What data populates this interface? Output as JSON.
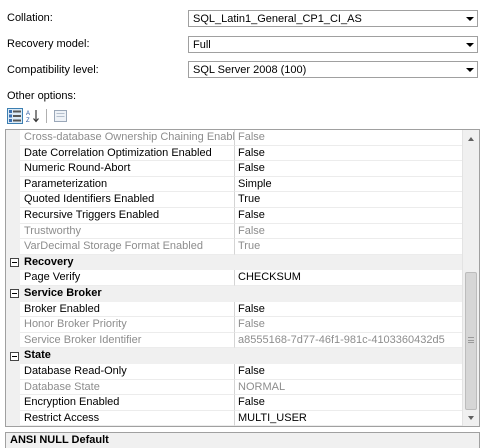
{
  "fields": {
    "collation": {
      "label": "Collation:",
      "value": "SQL_Latin1_General_CP1_CI_AS"
    },
    "recovery_model": {
      "label": "Recovery model:",
      "value": "Full"
    },
    "compatibility_level": {
      "label": "Compatibility level:",
      "value": "SQL Server 2008 (100)"
    }
  },
  "other_options_label": "Other options:",
  "toolbar": {
    "categorized_icon": "categorized-icon",
    "alphabetical_icon": "alphabetical-icon",
    "property_pages_icon": "property-pages-icon"
  },
  "grid": {
    "rows": [
      {
        "type": "prop",
        "name": "Cross-database Ownership Chaining Enabled",
        "value": "False",
        "disabled": true
      },
      {
        "type": "prop",
        "name": "Date Correlation Optimization Enabled",
        "value": "False",
        "disabled": false
      },
      {
        "type": "prop",
        "name": "Numeric Round-Abort",
        "value": "False",
        "disabled": false
      },
      {
        "type": "prop",
        "name": "Parameterization",
        "value": "Simple",
        "disabled": false
      },
      {
        "type": "prop",
        "name": "Quoted Identifiers Enabled",
        "value": "True",
        "disabled": false
      },
      {
        "type": "prop",
        "name": "Recursive Triggers Enabled",
        "value": "False",
        "disabled": false
      },
      {
        "type": "prop",
        "name": "Trustworthy",
        "value": "False",
        "disabled": true
      },
      {
        "type": "prop",
        "name": "VarDecimal Storage Format Enabled",
        "value": "True",
        "disabled": true
      },
      {
        "type": "category",
        "name": "Recovery"
      },
      {
        "type": "prop",
        "name": "Page Verify",
        "value": "CHECKSUM",
        "disabled": false
      },
      {
        "type": "category",
        "name": "Service Broker"
      },
      {
        "type": "prop",
        "name": "Broker Enabled",
        "value": "False",
        "disabled": false
      },
      {
        "type": "prop",
        "name": "Honor Broker Priority",
        "value": "False",
        "disabled": true
      },
      {
        "type": "prop",
        "name": "Service Broker Identifier",
        "value": "a8555168-7d77-46f1-981c-4103360432d5",
        "disabled": true
      },
      {
        "type": "category",
        "name": "State"
      },
      {
        "type": "prop",
        "name": "Database Read-Only",
        "value": "False",
        "disabled": false
      },
      {
        "type": "prop",
        "name": "Database State",
        "value": "NORMAL",
        "disabled": true
      },
      {
        "type": "prop",
        "name": "Encryption Enabled",
        "value": "False",
        "disabled": false
      },
      {
        "type": "prop",
        "name": "Restrict Access",
        "value": "MULTI_USER",
        "disabled": false
      }
    ]
  },
  "description": {
    "title": "ANSI NULL Default"
  }
}
